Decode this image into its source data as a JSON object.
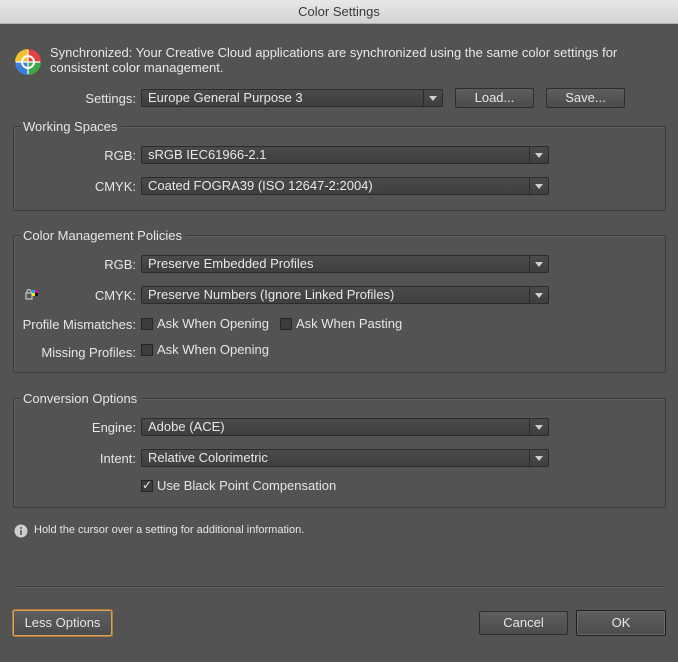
{
  "window": {
    "title": "Color Settings"
  },
  "sync": {
    "icon": "color-wheel-icon",
    "text": "Synchronized: Your Creative Cloud applications are synchronized using the same color settings for consistent color management."
  },
  "settings": {
    "label": "Settings:",
    "value": "Europe General Purpose 3",
    "load_label": "Load...",
    "save_label": "Save..."
  },
  "working_spaces": {
    "title": "Working Spaces",
    "rgb_label": "RGB:",
    "rgb_value": "sRGB IEC61966-2.1",
    "cmyk_label": "CMYK:",
    "cmyk_value": "Coated FOGRA39 (ISO 12647-2:2004)"
  },
  "policies": {
    "title": "Color Management Policies",
    "rgb_label": "RGB:",
    "rgb_value": "Preserve Embedded Profiles",
    "cmyk_icon": "lock-cmyk-icon",
    "cmyk_label": "CMYK:",
    "cmyk_value": "Preserve Numbers (Ignore Linked Profiles)",
    "mismatch_label": "Profile Mismatches:",
    "mismatch_opening": {
      "label": "Ask When Opening",
      "checked": false
    },
    "mismatch_pasting": {
      "label": "Ask When Pasting",
      "checked": false
    },
    "missing_label": "Missing Profiles:",
    "missing_opening": {
      "label": "Ask When Opening",
      "checked": false
    }
  },
  "conversion": {
    "title": "Conversion Options",
    "engine_label": "Engine:",
    "engine_value": "Adobe (ACE)",
    "intent_label": "Intent:",
    "intent_value": "Relative Colorimetric",
    "bpc": {
      "label": "Use Black Point Compensation",
      "checked": true
    }
  },
  "info": {
    "icon": "info-icon",
    "text": "Hold the cursor over a setting for additional information."
  },
  "footer": {
    "less_options_label": "Less Options",
    "cancel_label": "Cancel",
    "ok_label": "OK"
  },
  "colors": {
    "background": "#535353",
    "focus_ring": "#e0a060",
    "field": "#434343"
  }
}
